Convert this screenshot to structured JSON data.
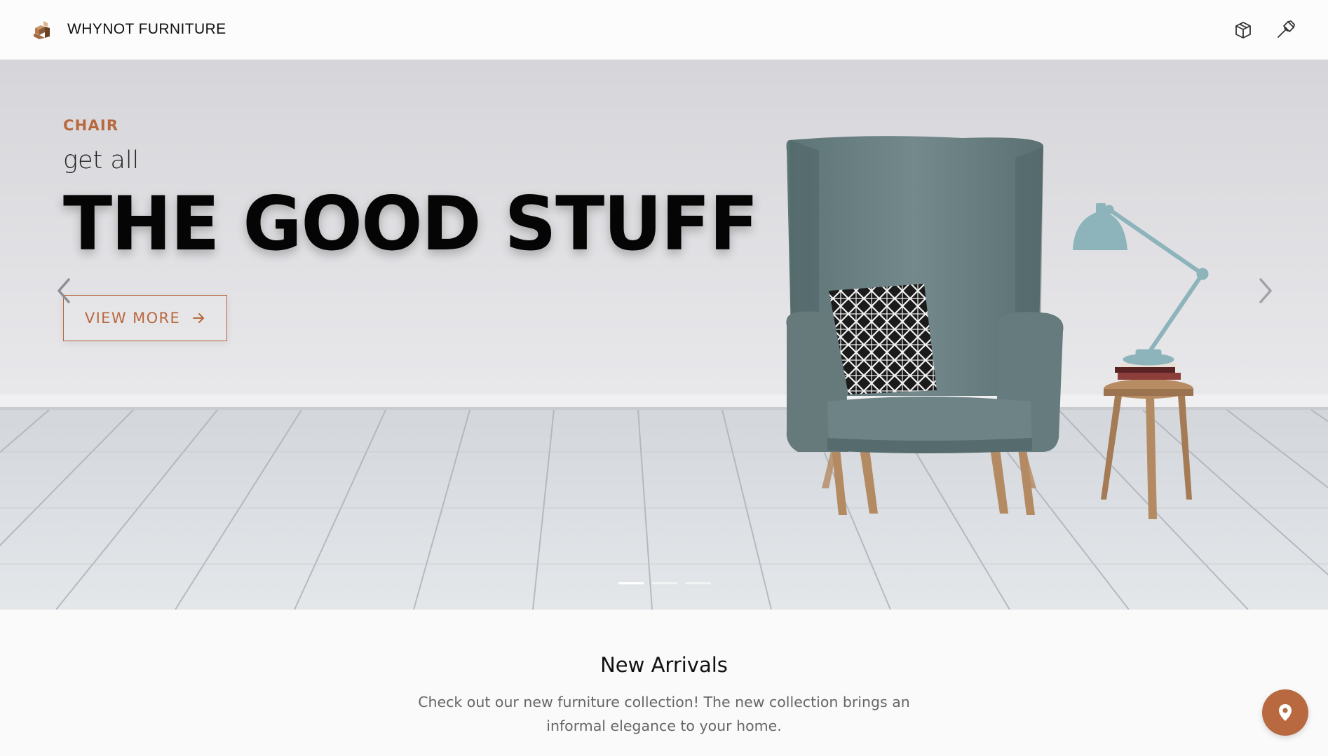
{
  "header": {
    "brand_name": "WHYNOT FURNITURE",
    "logo_icon": "armchair-logo-icon",
    "icons": [
      "cube-icon",
      "hammer-icon"
    ]
  },
  "hero": {
    "kicker": "CHAIR",
    "subtitle": "get all",
    "headline": "THE GOOD STUFF",
    "button_label": "VIEW MORE",
    "button_icon": "arrow-right-icon",
    "prev_icon": "chevron-left-icon",
    "next_icon": "chevron-right-icon",
    "slides_count": 3,
    "active_slide": 1
  },
  "new_arrivals": {
    "title": "New Arrivals",
    "description": "Check out our new furniture collection! The new collection brings an informal elegance to your home."
  },
  "fab": {
    "icon": "map-pin-icon"
  },
  "colors": {
    "accent": "#b8693f",
    "headline": "#050505",
    "page_bg": "#fafafa"
  }
}
